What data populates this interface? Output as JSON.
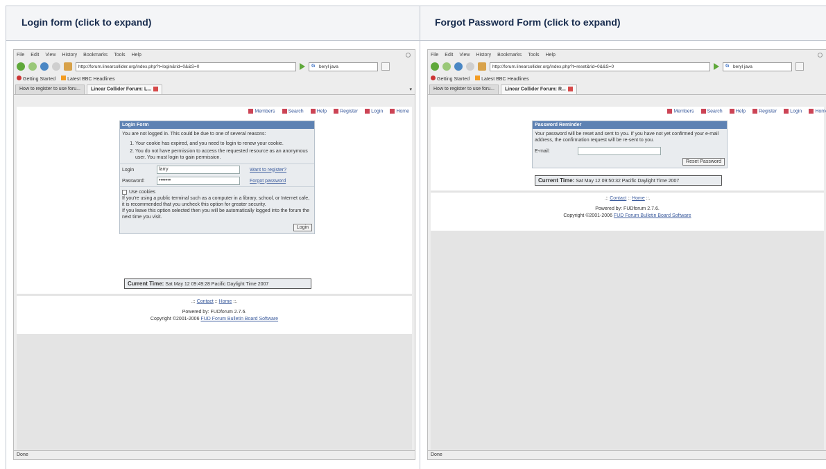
{
  "headers": {
    "login": "Login form (click to expand)",
    "forgot": "Forgot Password Form (click to expand)"
  },
  "browser": {
    "menu": [
      "File",
      "Edit",
      "View",
      "History",
      "Bookmarks",
      "Tools",
      "Help"
    ],
    "bookmarks": [
      "Getting Started",
      "Latest BBC Headlines"
    ],
    "search_value": "beryl java",
    "status": "Done",
    "tab_inactive": "How to register to use foru...",
    "login_url": "http://forum.linearcollider.org/index.php?t=login&rid=0&&S=0",
    "login_tab": "Linear Collider Forum: L...",
    "forgot_url": "http://forum.linearcollider.org/index.php?t=reset&rid=0&&S=0",
    "forgot_tab": "Linear Collider Forum: R..."
  },
  "toplinks": [
    "Members",
    "Search",
    "Help",
    "Register",
    "Login",
    "Home"
  ],
  "login_form": {
    "title": "Login Form",
    "intro": "You are not logged in. This could be due to one of several reasons:",
    "reason1": "Your cookie has expired, and you need to login to renew your cookie.",
    "reason2": "You do not have permission to access the requested resource as an anonymous user. You must login to gain permission.",
    "login_label": "Login",
    "login_value": "larry",
    "password_label": "Password:",
    "password_value": "•••••••",
    "register_link": "Want to register?",
    "forgot_link": "Forgot password",
    "cookies_label": "Use cookies",
    "cookies_note": "If you're using a public terminal such as a computer in a library, school, or Internet cafe, it is recommended that you uncheck this option for greater security.",
    "cookies_note2": "If you leave this option selected then you will be automatically logged into the forum the next time you visit.",
    "login_button": "Login",
    "time_label": "Current Time:",
    "time_value": "Sat May 12 09:49:28 Pacific Daylight Time 2007"
  },
  "forgot_form": {
    "title": "Password Reminder",
    "text": "Your password will be reset and sent to you. If you have not yet confirmed your e-mail address, the confirmation request will be re-sent to you.",
    "email_label": "E-mail:",
    "email_value": "",
    "reset_button": "Reset Password",
    "time_label": "Current Time:",
    "time_value": "Sat May 12 09:50:32 Pacific Daylight Time 2007"
  },
  "footer": {
    "open": ".::",
    "contact": "Contact",
    "sep": "::",
    "home": "Home",
    "close": "::.",
    "powered": "Powered by: FUDforum 2.7.6.",
    "copyright": "Copyright ©2001-2006",
    "copyright_link": "FUD Forum Bulletin Board Software"
  }
}
